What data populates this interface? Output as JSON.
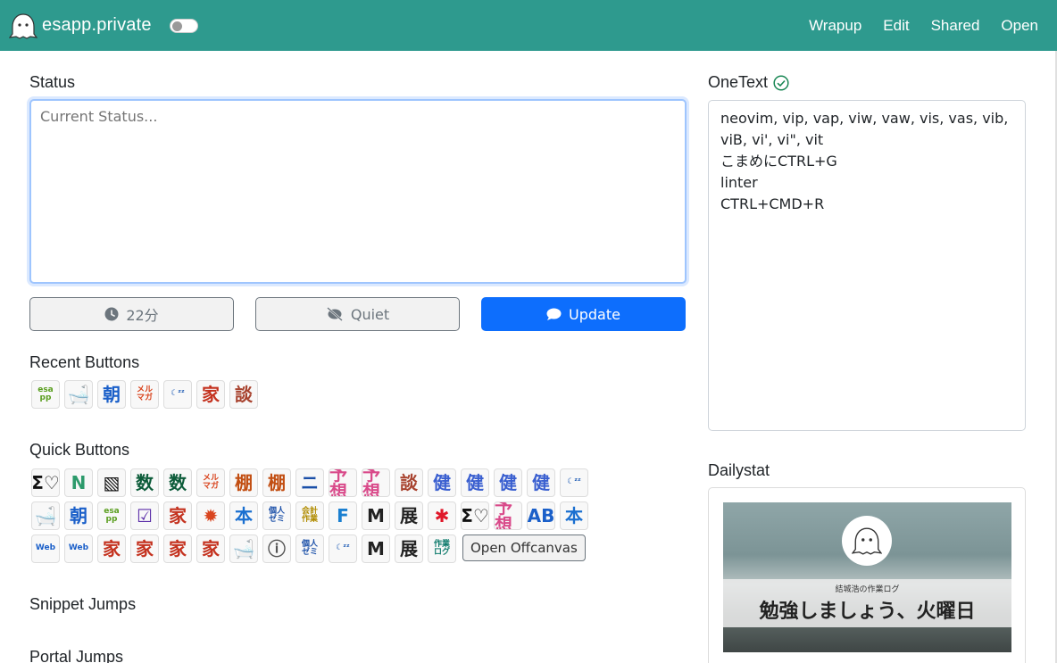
{
  "app": {
    "brand": "esapp.private",
    "nav": [
      "Wrapup",
      "Edit",
      "Shared",
      "Open"
    ]
  },
  "status": {
    "heading": "Status",
    "placeholder": "Current Status...",
    "time_button": "22分",
    "quiet_button": "Quiet",
    "update_button": "Update"
  },
  "recent": {
    "heading": "Recent Buttons",
    "buttons": [
      {
        "name": "esapp-icon",
        "text": "esa pp",
        "color": "#5a9e1f"
      },
      {
        "name": "bath-icon",
        "text": "🛁",
        "color": "#555"
      },
      {
        "name": "asa-icon",
        "text": "朝",
        "color": "#1a5fc9"
      },
      {
        "name": "mailmag-icon",
        "text": "メル マガ",
        "color": "#d9451f"
      },
      {
        "name": "sleep-icon",
        "text": "☾ᶻᶻ",
        "color": "#2a64b8"
      },
      {
        "name": "ie-icon",
        "text": "家",
        "color": "#c4321f"
      },
      {
        "name": "dan-icon",
        "text": "談",
        "color": "#a8432f"
      }
    ]
  },
  "quick": {
    "heading": "Quick Buttons",
    "rows": [
      [
        {
          "name": "sigma-heart-icon",
          "text": "Σ♡",
          "color": "#111"
        },
        {
          "name": "n-icon",
          "text": "N",
          "color": "#2c9a6b"
        },
        {
          "name": "stripe-icon",
          "text": "▧",
          "color": "#111"
        },
        {
          "name": "kazu-icon",
          "text": "数",
          "color": "#0d5c3a"
        },
        {
          "name": "kazu2-icon",
          "text": "数",
          "color": "#0d5c3a"
        },
        {
          "name": "mailmag-icon",
          "text": "メル マガ",
          "color": "#d9451f"
        },
        {
          "name": "tana-icon",
          "text": "棚",
          "color": "#c24e12"
        },
        {
          "name": "tana2-icon",
          "text": "棚",
          "color": "#c24e12"
        },
        {
          "name": "newsletter-icon",
          "text": "ニ",
          "color": "#1a4fa8"
        },
        {
          "name": "yosou-icon",
          "text": "予想",
          "color": "#d94a8a"
        },
        {
          "name": "yosou2-icon",
          "text": "予想",
          "color": "#d94a8a"
        },
        {
          "name": "dan-icon",
          "text": "談",
          "color": "#a8432f"
        },
        {
          "name": "ken-icon",
          "text": "健",
          "color": "#3a5fd0"
        },
        {
          "name": "ken2-icon",
          "text": "健",
          "color": "#3a5fd0"
        },
        {
          "name": "ken3-icon",
          "text": "健",
          "color": "#3a5fd0"
        },
        {
          "name": "ken4-icon",
          "text": "健",
          "color": "#3a5fd0"
        },
        {
          "name": "sleep-icon",
          "text": "☾ᶻᶻ",
          "color": "#2a64b8"
        }
      ],
      [
        {
          "name": "bath-icon",
          "text": "🛁",
          "color": "#555"
        },
        {
          "name": "asa-icon",
          "text": "朝",
          "color": "#1a5fc9"
        },
        {
          "name": "esapp-icon",
          "text": "esa pp",
          "color": "#5a9e1f"
        },
        {
          "name": "check-square-icon",
          "text": "☑",
          "color": "#5a2da8"
        },
        {
          "name": "ie-icon",
          "text": "家",
          "color": "#c4321f"
        },
        {
          "name": "burst-icon",
          "text": "✹",
          "color": "#d9451f"
        },
        {
          "name": "book-icon",
          "text": "本",
          "color": "#1a6fd0"
        },
        {
          "name": "kojin-zemi-icon",
          "text": "個人 ゼミ",
          "color": "#1a4fa8"
        },
        {
          "name": "kaikei-icon",
          "text": "会計 作業",
          "color": "#b08b00"
        },
        {
          "name": "f-icon",
          "text": "F",
          "color": "#1a7fd0"
        },
        {
          "name": "m-icon",
          "text": "M",
          "color": "#222"
        },
        {
          "name": "ten-icon",
          "text": "展",
          "color": "#222"
        },
        {
          "name": "asterisk-icon",
          "text": "✱",
          "color": "#e0182a"
        },
        {
          "name": "sigma-heart-icon",
          "text": "Σ♡",
          "color": "#111"
        },
        {
          "name": "yosou-icon",
          "text": "予想",
          "color": "#d94a8a"
        },
        {
          "name": "ab-icon",
          "text": "AB",
          "color": "#1a5fc9"
        },
        {
          "name": "book2-icon",
          "text": "本",
          "color": "#1a6fd0"
        }
      ],
      [
        {
          "name": "web-icon",
          "text": "Web",
          "color": "#1a5fc9"
        },
        {
          "name": "web2-icon",
          "text": "Web",
          "color": "#1a5fc9"
        },
        {
          "name": "ie-icon",
          "text": "家",
          "color": "#c4321f"
        },
        {
          "name": "ie2-icon",
          "text": "家",
          "color": "#c4321f"
        },
        {
          "name": "ie3-icon",
          "text": "家",
          "color": "#c4321f"
        },
        {
          "name": "ie4-icon",
          "text": "家",
          "color": "#c4321f"
        },
        {
          "name": "bath-icon",
          "text": "🛁",
          "color": "#555"
        },
        {
          "name": "ghost-info-icon",
          "text": "ⓘ",
          "color": "#555"
        },
        {
          "name": "kojin-zemi-icon",
          "text": "個人 ゼミ",
          "color": "#1a4fa8"
        },
        {
          "name": "sleep-icon",
          "text": "☾ᶻᶻ",
          "color": "#2a64b8"
        },
        {
          "name": "m-icon",
          "text": "M",
          "color": "#222"
        },
        {
          "name": "ten-icon",
          "text": "展",
          "color": "#222"
        },
        {
          "name": "sagyou-log-icon",
          "text": "作業 ログ",
          "color": "#0d7a6b"
        }
      ]
    ],
    "offcanvas_button": "Open Offcanvas"
  },
  "snippet": {
    "heading": "Snippet Jumps"
  },
  "portal": {
    "heading": "Portal Jumps"
  },
  "onetext": {
    "heading": "OneText",
    "content": "neovim, vip, vap, viw, vaw, vis, vas, vib,\nviB, vi', vi\", vit\nこまめにCTRL+G\nlinter\nCTRL+CMD+R"
  },
  "dailystat": {
    "heading": "Dailystat",
    "image_subtitle": "結城浩の作業ログ",
    "image_title": "勉強しましょう、火曜日"
  }
}
